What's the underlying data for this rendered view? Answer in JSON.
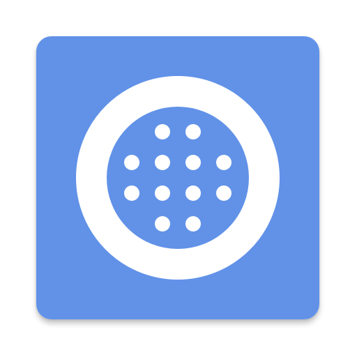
{
  "icon": {
    "name": "keypad-ring-icon",
    "background_color": "#6192E8",
    "foreground_color": "#FFFFFF",
    "dot_rows": [
      2,
      4,
      4,
      2
    ]
  }
}
